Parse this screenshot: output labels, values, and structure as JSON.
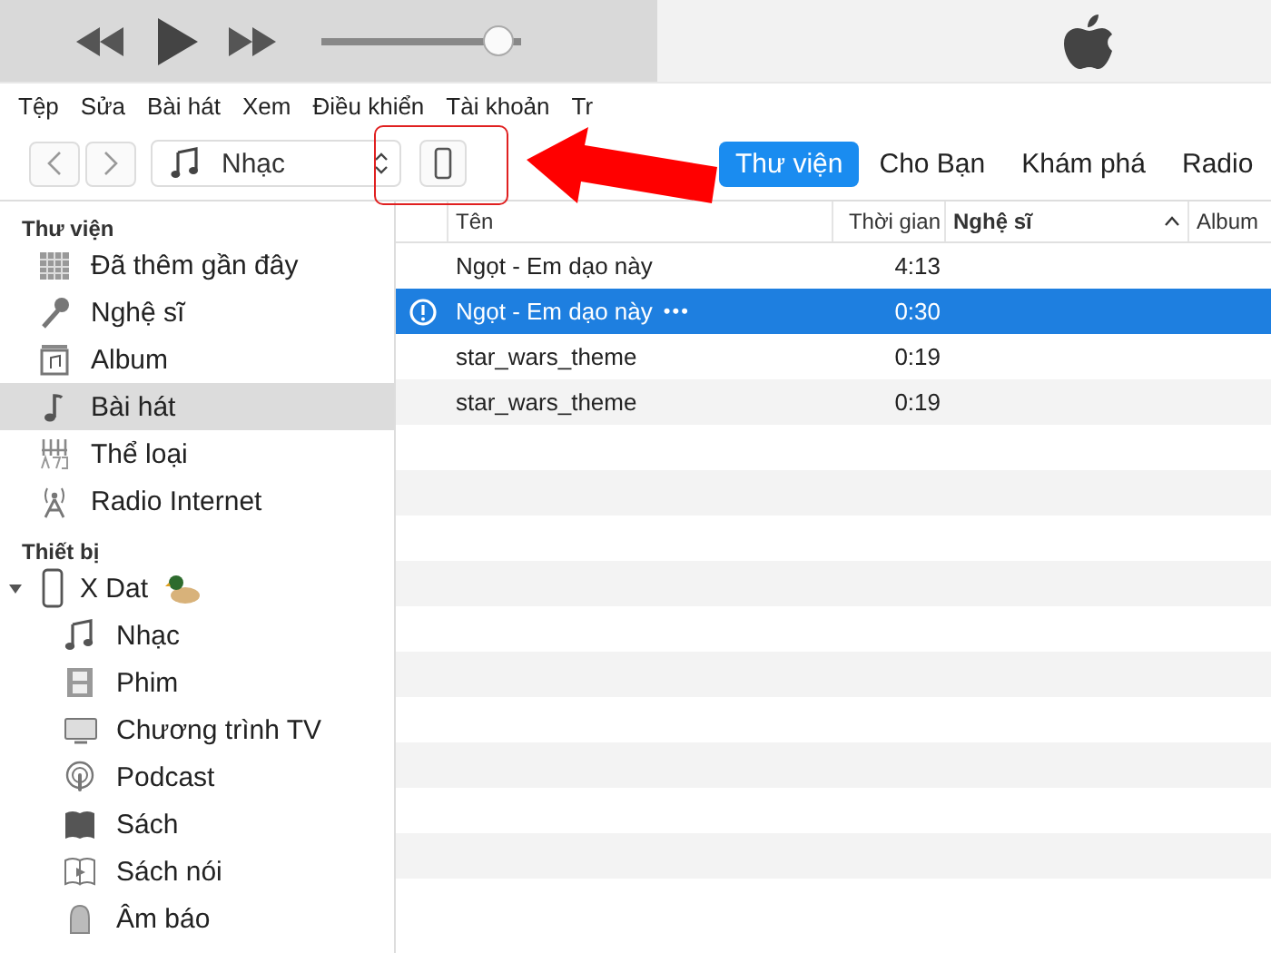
{
  "player": {
    "volume": {
      "level": 0.9
    }
  },
  "menu": [
    "Tệp",
    "Sửa",
    "Bài hát",
    "Xem",
    "Điều khiển",
    "Tài khoản",
    "Tr"
  ],
  "toolbar": {
    "media_picker": {
      "value": "Nhạc"
    },
    "tabs": [
      {
        "label": "Thư viện",
        "selected": true
      },
      {
        "label": "Cho Bạn",
        "selected": false
      },
      {
        "label": "Khám phá",
        "selected": false
      },
      {
        "label": "Radio",
        "selected": false
      }
    ]
  },
  "sidebar": {
    "sections": [
      {
        "title": "Thư viện",
        "items": [
          {
            "label": "Đã thêm gần đây",
            "selected": false
          },
          {
            "label": "Nghệ sĩ",
            "selected": false
          },
          {
            "label": "Album",
            "selected": false
          },
          {
            "label": "Bài hát",
            "selected": true
          },
          {
            "label": "Thể loại",
            "selected": false
          },
          {
            "label": "Radio Internet",
            "selected": false
          }
        ]
      },
      {
        "title": "Thiết bị",
        "devices": [
          {
            "label": "X Dat",
            "expanded": true,
            "children": [
              {
                "label": "Nhạc",
                "selected": false
              },
              {
                "label": "Phim",
                "selected": false
              },
              {
                "label": "Chương trình TV",
                "selected": false
              },
              {
                "label": "Podcast",
                "selected": false
              },
              {
                "label": "Sách",
                "selected": false
              },
              {
                "label": "Sách nói",
                "selected": false
              },
              {
                "label": "Âm báo",
                "selected": false
              }
            ]
          }
        ]
      }
    ]
  },
  "table": {
    "columns": [
      {
        "label": "Tên",
        "sorted": false
      },
      {
        "label": "Thời gian",
        "sorted": false
      },
      {
        "label": "Nghệ sĩ",
        "sorted": true
      },
      {
        "label": "Album",
        "sorted": false
      }
    ],
    "rows": [
      {
        "name": "Ngọt - Em dạo này",
        "time": "4:13",
        "selected": false,
        "alert": false
      },
      {
        "name": "Ngọt - Em dạo này",
        "more": "•••",
        "time": "0:30",
        "selected": true,
        "alert": true
      },
      {
        "name": "star_wars_theme",
        "time": "0:19",
        "selected": false,
        "alert": false
      },
      {
        "name": "star_wars_theme",
        "time": "0:19",
        "selected": false,
        "alert": false
      }
    ]
  }
}
